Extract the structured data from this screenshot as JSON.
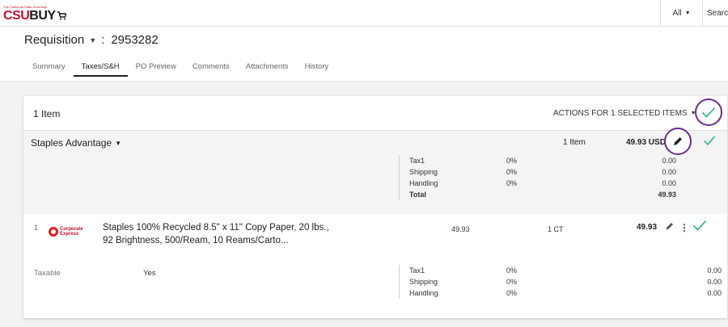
{
  "topbar": {
    "logo_tag": "The California State University",
    "logo_brand": "CSU",
    "logo_rest": "BUY",
    "scope_select": "All",
    "search_label": "Search"
  },
  "requisition": {
    "label": "Requisition",
    "separator": ":",
    "number": "2953282"
  },
  "tabs": [
    {
      "label": "Summary",
      "active": false
    },
    {
      "label": "Taxes/S&H",
      "active": true
    },
    {
      "label": "PO Preview",
      "active": false
    },
    {
      "label": "Comments",
      "active": false
    },
    {
      "label": "Attachments",
      "active": false
    },
    {
      "label": "History",
      "active": false
    }
  ],
  "card": {
    "items_count": "1 Item",
    "actions_label": "ACTIONS FOR 1 SELECTED ITEMS"
  },
  "supplier": {
    "name": "Staples Advantage",
    "items": "1 Item",
    "total": "49.93 USD",
    "taxes": [
      {
        "label": "Tax1",
        "pct": "0%",
        "amount": "0.00"
      },
      {
        "label": "Shipping",
        "pct": "0%",
        "amount": "0.00"
      },
      {
        "label": "Handling",
        "pct": "0%",
        "amount": "0.00"
      },
      {
        "label": "Total",
        "pct": "",
        "amount": "49.93"
      }
    ]
  },
  "line_item": {
    "number": "1",
    "logo_line1": "Corporate",
    "logo_line2": "Express",
    "description": "Staples 100% Recycled 8.5\" x 11\" Copy Paper, 20 lbs., 92 Brightness, 500/Ream, 10 Reams/Carto...",
    "unit_price": "49.93",
    "quantity": "1 CT",
    "total": "49.93",
    "taxable_label": "Taxable",
    "taxable_value": "Yes",
    "taxes": [
      {
        "label": "Tax1",
        "pct": "0%",
        "amount": "0.00"
      },
      {
        "label": "Shipping",
        "pct": "0%",
        "amount": "0.00"
      },
      {
        "label": "Handling",
        "pct": "0%",
        "amount": "0.00"
      }
    ]
  },
  "colors": {
    "brand_red": "#c8102e",
    "check_green": "#2bb07f",
    "highlight_purple": "#6a2c91"
  }
}
